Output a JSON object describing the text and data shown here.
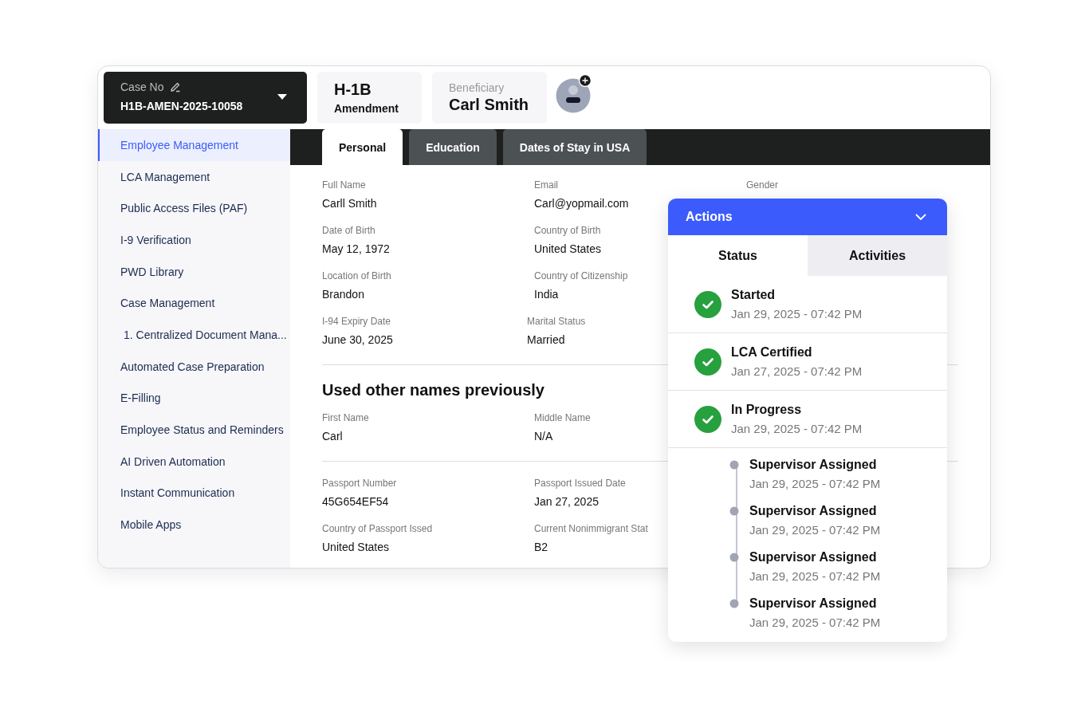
{
  "case": {
    "label": "Case No",
    "number": "H1B-AMEN-2025-10058"
  },
  "visa": {
    "type": "H-1B",
    "subtype": "Amendment"
  },
  "beneficiary": {
    "label": "Beneficiary",
    "name": "Carl Smith"
  },
  "sidebar": {
    "items": [
      {
        "label": "Employee Management",
        "selected": true
      },
      {
        "label": "LCA Management",
        "selected": false
      },
      {
        "label": "Public Access Files (PAF)",
        "selected": false
      },
      {
        "label": "I-9 Verification",
        "selected": false
      },
      {
        "label": "PWD Library",
        "selected": false
      },
      {
        "label": "Case Management",
        "selected": false,
        "children": [
          {
            "label": "1. Centralized Document Mana...",
            "selected": false
          }
        ]
      },
      {
        "label": "Automated Case Preparation",
        "selected": false
      },
      {
        "label": "E-Filling",
        "selected": false
      },
      {
        "label": "Employee Status and Reminders",
        "selected": false
      },
      {
        "label": "AI Driven Automation",
        "selected": false
      },
      {
        "label": "Instant Communication",
        "selected": false
      },
      {
        "label": "Mobile Apps",
        "selected": false
      }
    ]
  },
  "tabs": [
    {
      "label": "Personal",
      "selected": true
    },
    {
      "label": "Education",
      "selected": false
    },
    {
      "label": "Dates of Stay in USA",
      "selected": false
    }
  ],
  "sections": [
    {
      "rows": [
        [
          {
            "label": "Full Name",
            "value": "Carll Smith"
          },
          {
            "label": "Email",
            "value": "Carl@yopmail.com"
          },
          {
            "label": "Gender"
          }
        ],
        [
          {
            "label": "Date of Birth",
            "value": "May 12, 1972"
          },
          {
            "label": "Country of Birth",
            "value": "United States"
          }
        ],
        [
          {
            "label": "Location of Birth",
            "value": "Brandon"
          },
          {
            "label": "Country of Citizenship",
            "value": "India"
          }
        ],
        [
          {
            "label": "I-94 Expiry Date",
            "value": "June 30, 2025"
          },
          {
            "label": "Marital Status",
            "value": "Married"
          }
        ]
      ]
    },
    {
      "heading": "Used other names previously",
      "rows": [
        [
          {
            "label": "First Name",
            "value": "Carl"
          },
          {
            "label": "Middle Name",
            "value": "N/A"
          }
        ]
      ]
    },
    {
      "rows": [
        [
          {
            "label": "Passport Number",
            "value": "45G654EF54"
          },
          {
            "label": "Passport Issued Date",
            "value": "Jan 27, 2025"
          }
        ],
        [
          {
            "label": "Country of Passport Issed",
            "value": "United States"
          },
          {
            "label": "Current Nonimmigrant Stat",
            "value": "B2"
          }
        ]
      ]
    }
  ],
  "actions": {
    "title": "Actions",
    "tabs": [
      {
        "label": "Status",
        "selected": true
      },
      {
        "label": "Activities",
        "selected": false
      }
    ],
    "items": [
      {
        "kind": "check",
        "title": "Started",
        "date": "Jan 29, 2025 - 07:42 PM"
      },
      {
        "kind": "check",
        "title": "LCA Certified",
        "date": "Jan 27, 2025 - 07:42 PM"
      },
      {
        "kind": "check",
        "title": "In Progress",
        "date": "Jan 29, 2025 - 07:42 PM"
      },
      {
        "kind": "dot",
        "title": "Supervisor Assigned",
        "date": "Jan 29, 2025 - 07:42 PM"
      },
      {
        "kind": "dot",
        "title": "Supervisor Assigned",
        "date": "Jan 29, 2025 - 07:42 PM"
      },
      {
        "kind": "dot",
        "title": "Supervisor Assigned",
        "date": "Jan 29, 2025 - 07:42 PM"
      },
      {
        "kind": "dot",
        "title": "Supervisor Assigned",
        "date": "Jan 29, 2025 - 07:42 PM"
      }
    ]
  }
}
